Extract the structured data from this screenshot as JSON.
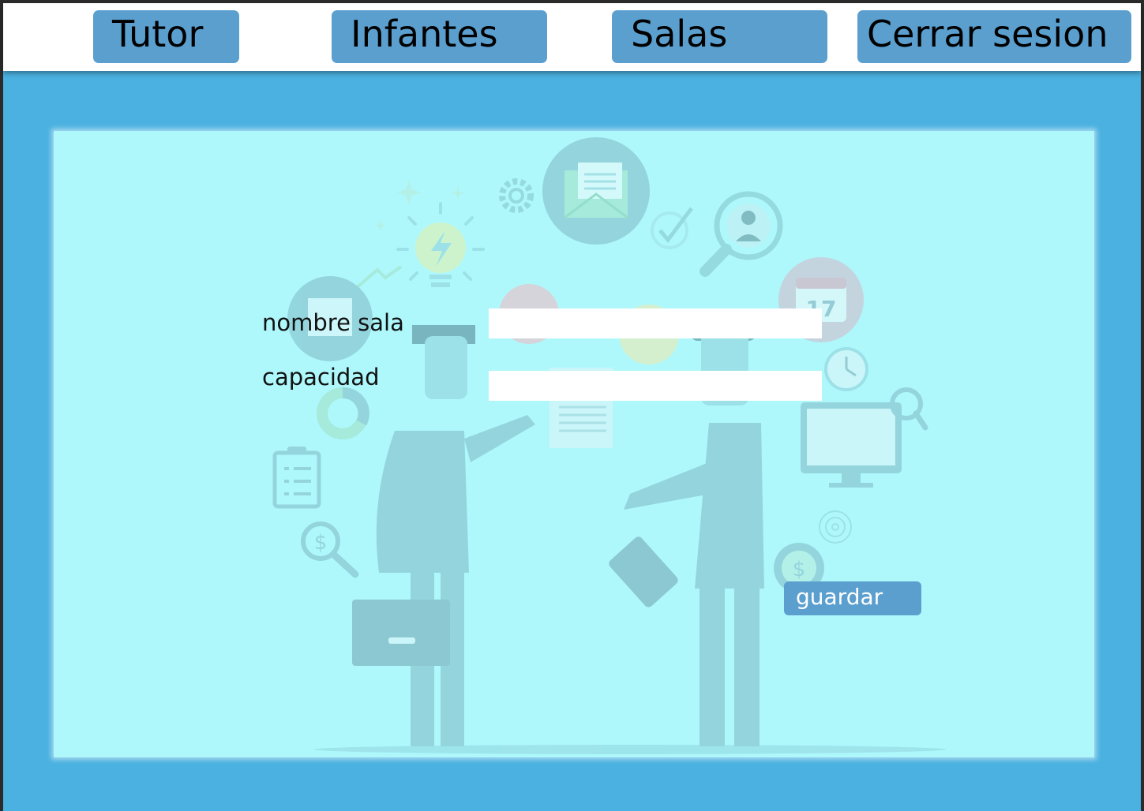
{
  "nav": {
    "tutor": "Tutor",
    "infantes": "Infantes",
    "salas": "Salas",
    "logout": "Cerrar sesion"
  },
  "form": {
    "name_label": "nombre sala",
    "name_value": "",
    "capacity_label": "capacidad",
    "capacity_value": "",
    "save_label": "guardar"
  },
  "illustration": {
    "calendar_day": "17"
  },
  "colors": {
    "frame": "#4ab1e0",
    "panel": "#aef8fc",
    "button": "#5b9fcf",
    "topbar": "#ffffff"
  }
}
